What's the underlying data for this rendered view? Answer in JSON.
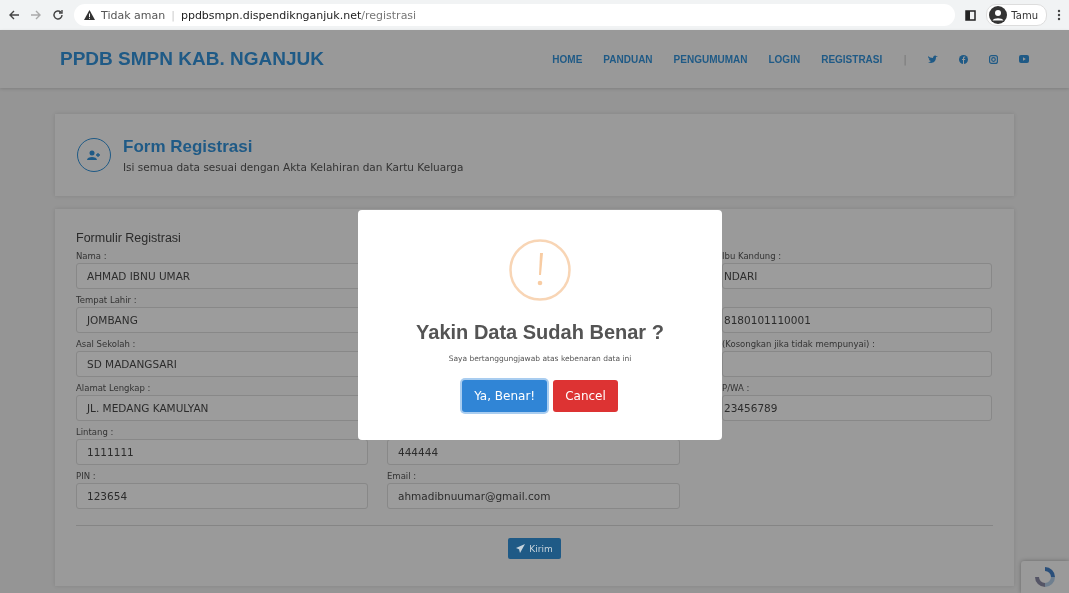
{
  "browser": {
    "security": "Tidak aman",
    "divider": "|",
    "host": "ppdbsmpn.dispendiknganjuk.net",
    "path": "/registrasi",
    "profile": "Tamu"
  },
  "nav": {
    "brand": "PPDB SMPN KAB. NGANJUK",
    "links": [
      "HOME",
      "PANDUAN",
      "PENGUMUMAN",
      "LOGIN",
      "REGISTRASI"
    ],
    "separator": "|"
  },
  "header": {
    "title": "Form Registrasi",
    "subtitle": "Isi semua data sesuai dengan Akta Kelahiran dan Kartu Keluarga"
  },
  "form": {
    "title": "Formulir Registrasi",
    "left": [
      {
        "label": "Nama :",
        "value": "AHMAD IBNU UMAR"
      },
      {
        "label": "Tempat Lahir :",
        "value": "JOMBANG"
      },
      {
        "label": "Asal Sekolah :",
        "value": "SD MADANGSARI"
      },
      {
        "label": "Alamat Lengkap :",
        "value": "JL. MEDANG KAMULYAN"
      },
      {
        "label": "Lintang :",
        "value": "1111111"
      },
      {
        "label": "PIN :",
        "value": "123654"
      }
    ],
    "middle": [
      {
        "value": "444444"
      },
      {
        "label": "Email :",
        "value": "ahmadibnuumar@gmail.com"
      }
    ],
    "right": [
      {
        "label": "Ibu Kandung :",
        "value": "NDARI"
      },
      {
        "value": "8180101110001"
      },
      {
        "label": "(Kosongkan jika tidak mempunyai) :"
      },
      {
        "label": "P/WA :",
        "value": "23456789"
      }
    ],
    "submit": "Kirim"
  },
  "dialog": {
    "title": "Yakin Data Sudah Benar ?",
    "message": "Saya bertanggungjawab atas kebenaran data ini",
    "buttons": [
      {
        "label": "Ya, Benar!",
        "kind": "confirm"
      },
      {
        "label": "Cancel",
        "kind": "cancel"
      }
    ]
  }
}
